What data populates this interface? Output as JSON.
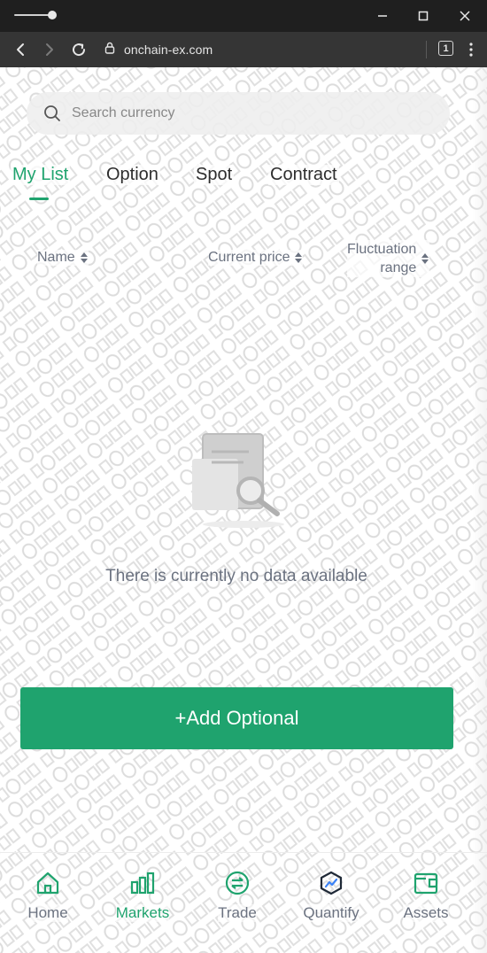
{
  "browser": {
    "url": "onchain-ex.com",
    "tab_count": "1"
  },
  "search": {
    "placeholder": "Search currency"
  },
  "tabs": [
    {
      "label": "My List",
      "active": true
    },
    {
      "label": "Option",
      "active": false
    },
    {
      "label": "Spot",
      "active": false
    },
    {
      "label": "Contract",
      "active": false
    }
  ],
  "columns": {
    "name": "Name",
    "price": "Current price",
    "fluct_line1": "Fluctuation",
    "fluct_line2": "range"
  },
  "empty_message": "There is currently no data available",
  "add_button": "+Add Optional",
  "bottom_nav": [
    {
      "label": "Home",
      "icon": "home-icon",
      "active": false
    },
    {
      "label": "Markets",
      "icon": "markets-icon",
      "active": true
    },
    {
      "label": "Trade",
      "icon": "trade-icon",
      "active": false
    },
    {
      "label": "Quantify",
      "icon": "quantify-icon",
      "active": false
    },
    {
      "label": "Assets",
      "icon": "assets-icon",
      "active": false
    }
  ],
  "colors": {
    "accent": "#1fa36e",
    "muted_text": "#6b7280",
    "browser_chrome": "#1f1f1f",
    "address_bar": "#353535"
  }
}
